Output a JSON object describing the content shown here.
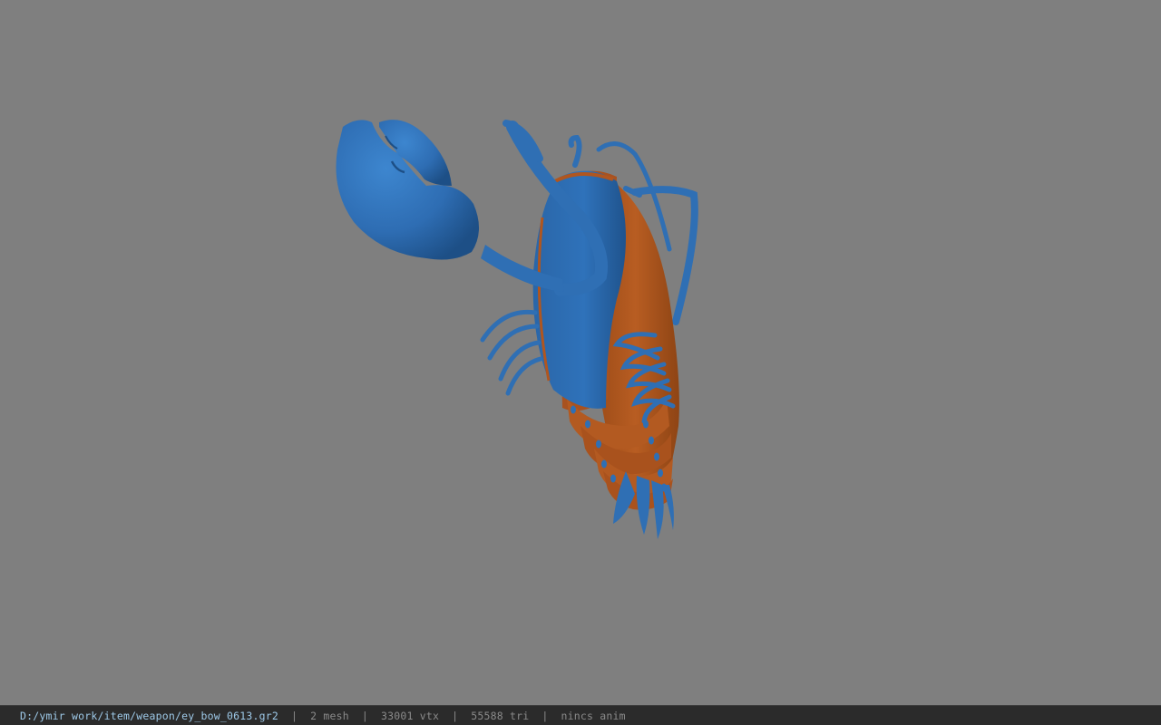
{
  "viewport": {
    "background_color": "#7f7f7f",
    "model": {
      "subject": "lobster-shaped bow model",
      "shell_color": "#b0561f",
      "body_color": "#2f6fb4"
    }
  },
  "status_bar": {
    "file_path": "D:/ymir work/item/weapon/ey_bow_0613.gr2",
    "mesh_count": "2 mesh",
    "vertex_count": "33001 vtx",
    "triangle_count": "55588 tri",
    "anim_status": "nincs anim",
    "separator": "|"
  }
}
